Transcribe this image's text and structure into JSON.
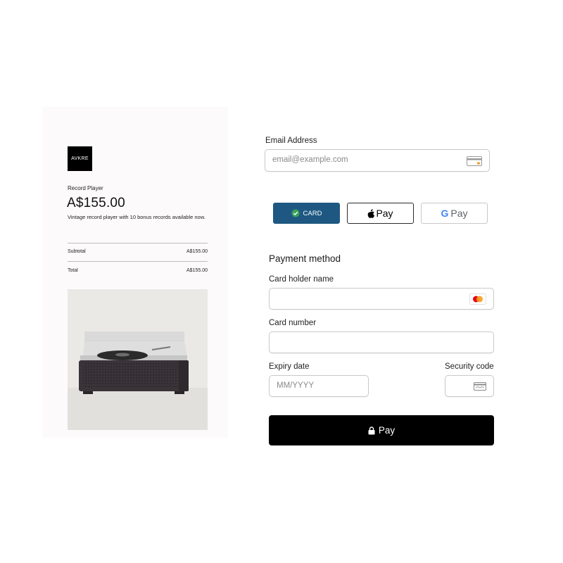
{
  "product": {
    "brand": "AVKRE",
    "label": "Record Player",
    "price": "A$155.00",
    "description": "Vintage record player with 10 bonus records available now.",
    "subtotal_label": "Subtotal",
    "subtotal_value": "A$155.00",
    "total_label": "Total",
    "total_value": "A$155.00",
    "image_icon": "turntable-image"
  },
  "email": {
    "label": "Email Address",
    "placeholder": "email@example.com",
    "icon": "credit-card-icon"
  },
  "payment_options": {
    "card_label": "CARD",
    "apple_label": "Pay",
    "google_label": "Pay",
    "selected": "card"
  },
  "form": {
    "heading": "Payment method",
    "cardholder_label": "Card holder name",
    "cardholder_value": "",
    "card_number_label": "Card number",
    "card_number_value": "",
    "expiry_label": "Expiry date",
    "expiry_placeholder": "MM/YYYY",
    "security_label": "Security code",
    "pay_label": "Pay"
  },
  "colors": {
    "card_selected": "#1e5882",
    "check": "#3aa05a",
    "pay_button": "#000000",
    "mastercard_red": "#eb001b",
    "mastercard_orange": "#f79e1b"
  }
}
